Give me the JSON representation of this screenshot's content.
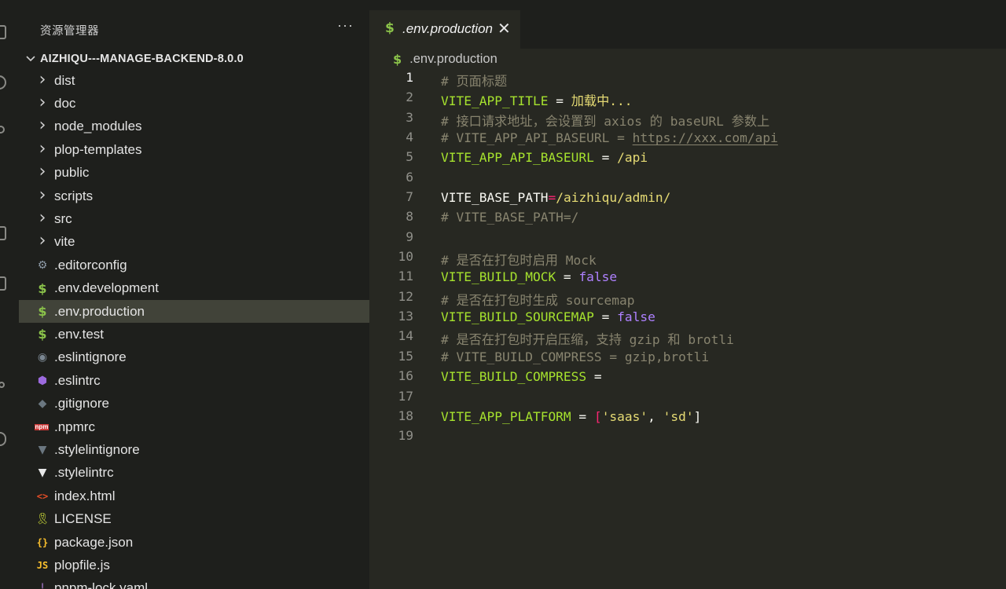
{
  "sidebar": {
    "title": "资源管理器",
    "more": "···",
    "project": "AIZHIQU---MANAGE-BACKEND-8.0.0",
    "items": [
      {
        "label": "dist",
        "icon": "chevron-right-icon",
        "glyph": "›",
        "color": "#cfcfcf"
      },
      {
        "label": "doc",
        "icon": "chevron-right-icon",
        "glyph": "›",
        "color": "#cfcfcf"
      },
      {
        "label": "node_modules",
        "icon": "chevron-right-icon",
        "glyph": "›",
        "color": "#cfcfcf"
      },
      {
        "label": "plop-templates",
        "icon": "chevron-right-icon",
        "glyph": "›",
        "color": "#cfcfcf"
      },
      {
        "label": "public",
        "icon": "chevron-right-icon",
        "glyph": "›",
        "color": "#cfcfcf"
      },
      {
        "label": "scripts",
        "icon": "chevron-right-icon",
        "glyph": "›",
        "color": "#cfcfcf"
      },
      {
        "label": "src",
        "icon": "chevron-right-icon",
        "glyph": "›",
        "color": "#cfcfcf"
      },
      {
        "label": "vite",
        "icon": "chevron-right-icon",
        "glyph": "›",
        "color": "#cfcfcf"
      },
      {
        "label": ".editorconfig",
        "icon": "gear-icon",
        "glyph": "⚙",
        "color": "#8e9ba8"
      },
      {
        "label": ".env.development",
        "icon": "dollar-icon",
        "glyph": "$",
        "color": "#8bc34a"
      },
      {
        "label": ".env.production",
        "icon": "dollar-icon",
        "glyph": "$",
        "color": "#8bc34a",
        "active": true
      },
      {
        "label": ".env.test",
        "icon": "dollar-icon",
        "glyph": "$",
        "color": "#8bc34a"
      },
      {
        "label": ".eslintignore",
        "icon": "eslint-ignore-icon",
        "glyph": "◉",
        "color": "#7b8792"
      },
      {
        "label": ".eslintrc",
        "icon": "eslint-icon",
        "glyph": "⬢",
        "color": "#9c6ade"
      },
      {
        "label": ".gitignore",
        "icon": "git-icon",
        "glyph": "◆",
        "color": "#6b7780"
      },
      {
        "label": ".npmrc",
        "icon": "npm-icon",
        "glyph": "npm",
        "color": "#cb3837"
      },
      {
        "label": ".stylelintignore",
        "icon": "stylelint-ignore-icon",
        "glyph": "▼",
        "color": "#6b7780"
      },
      {
        "label": ".stylelintrc",
        "icon": "stylelint-icon",
        "glyph": "▼",
        "color": "#e8e8e8"
      },
      {
        "label": "index.html",
        "icon": "html-icon",
        "glyph": "<>",
        "color": "#e44d26"
      },
      {
        "label": "LICENSE",
        "icon": "license-icon",
        "glyph": "🎗",
        "color": "#cddc39"
      },
      {
        "label": "package.json",
        "icon": "json-icon",
        "glyph": "{}",
        "color": "#fbc02d"
      },
      {
        "label": "plopfile.js",
        "icon": "javascript-icon",
        "glyph": "JS",
        "color": "#fbc02d"
      },
      {
        "label": "pnpm-lock.yaml",
        "icon": "yaml-icon",
        "glyph": "!",
        "color": "#a074c4"
      }
    ]
  },
  "editor": {
    "tab": {
      "label": ".env.production",
      "close": "✕"
    },
    "breadcrumb": ".env.production",
    "current_line": 1,
    "lines": [
      {
        "n": "1",
        "parts": [
          {
            "c": "c",
            "t": "# 页面标题"
          }
        ]
      },
      {
        "n": "2",
        "parts": [
          {
            "c": "k",
            "t": "VITE_APP_TITLE"
          },
          {
            "c": "p",
            "t": " = "
          },
          {
            "c": "s",
            "t": "加载中..."
          }
        ]
      },
      {
        "n": "3",
        "parts": [
          {
            "c": "c",
            "t": "# 接口请求地址，会设置到 axios 的 baseURL 参数上"
          }
        ]
      },
      {
        "n": "4",
        "parts": [
          {
            "c": "c",
            "t": "# VITE_APP_API_BASEURL = "
          },
          {
            "c": "c u",
            "t": "https://xxx.com/api"
          }
        ]
      },
      {
        "n": "5",
        "parts": [
          {
            "c": "k",
            "t": "VITE_APP_API_BASEURL"
          },
          {
            "c": "p",
            "t": " = "
          },
          {
            "c": "s",
            "t": "/api"
          }
        ]
      },
      {
        "n": "6",
        "parts": []
      },
      {
        "n": "7",
        "parts": [
          {
            "c": "w",
            "t": "VITE_BASE_PATH"
          },
          {
            "c": "o",
            "t": "="
          },
          {
            "c": "s",
            "t": "/aizhiqu/admin/"
          }
        ]
      },
      {
        "n": "8",
        "parts": [
          {
            "c": "c",
            "t": "# VITE_BASE_PATH=/"
          }
        ]
      },
      {
        "n": "9",
        "parts": []
      },
      {
        "n": "10",
        "parts": [
          {
            "c": "c",
            "t": "# 是否在打包时启用 Mock"
          }
        ]
      },
      {
        "n": "11",
        "parts": [
          {
            "c": "k",
            "t": "VITE_BUILD_MOCK"
          },
          {
            "c": "p",
            "t": " = "
          },
          {
            "c": "b",
            "t": "false"
          }
        ]
      },
      {
        "n": "12",
        "parts": [
          {
            "c": "c",
            "t": "# 是否在打包时生成 sourcemap"
          }
        ]
      },
      {
        "n": "13",
        "parts": [
          {
            "c": "k",
            "t": "VITE_BUILD_SOURCEMAP"
          },
          {
            "c": "p",
            "t": " = "
          },
          {
            "c": "b",
            "t": "false"
          }
        ]
      },
      {
        "n": "14",
        "parts": [
          {
            "c": "c",
            "t": "# 是否在打包时开启压缩，支持 gzip 和 brotli"
          }
        ]
      },
      {
        "n": "15",
        "parts": [
          {
            "c": "c",
            "t": "# VITE_BUILD_COMPRESS = gzip,brotli"
          }
        ]
      },
      {
        "n": "16",
        "parts": [
          {
            "c": "k",
            "t": "VITE_BUILD_COMPRESS"
          },
          {
            "c": "p",
            "t": " ="
          }
        ]
      },
      {
        "n": "17",
        "parts": []
      },
      {
        "n": "18",
        "parts": [
          {
            "c": "k",
            "t": "VITE_APP_PLATFORM"
          },
          {
            "c": "p",
            "t": " = "
          },
          {
            "c": "o",
            "t": "["
          },
          {
            "c": "s",
            "t": "'saas'"
          },
          {
            "c": "p",
            "t": ", "
          },
          {
            "c": "s",
            "t": "'sd'"
          },
          {
            "c": "p",
            "t": "]"
          }
        ]
      },
      {
        "n": "19",
        "parts": []
      }
    ]
  }
}
